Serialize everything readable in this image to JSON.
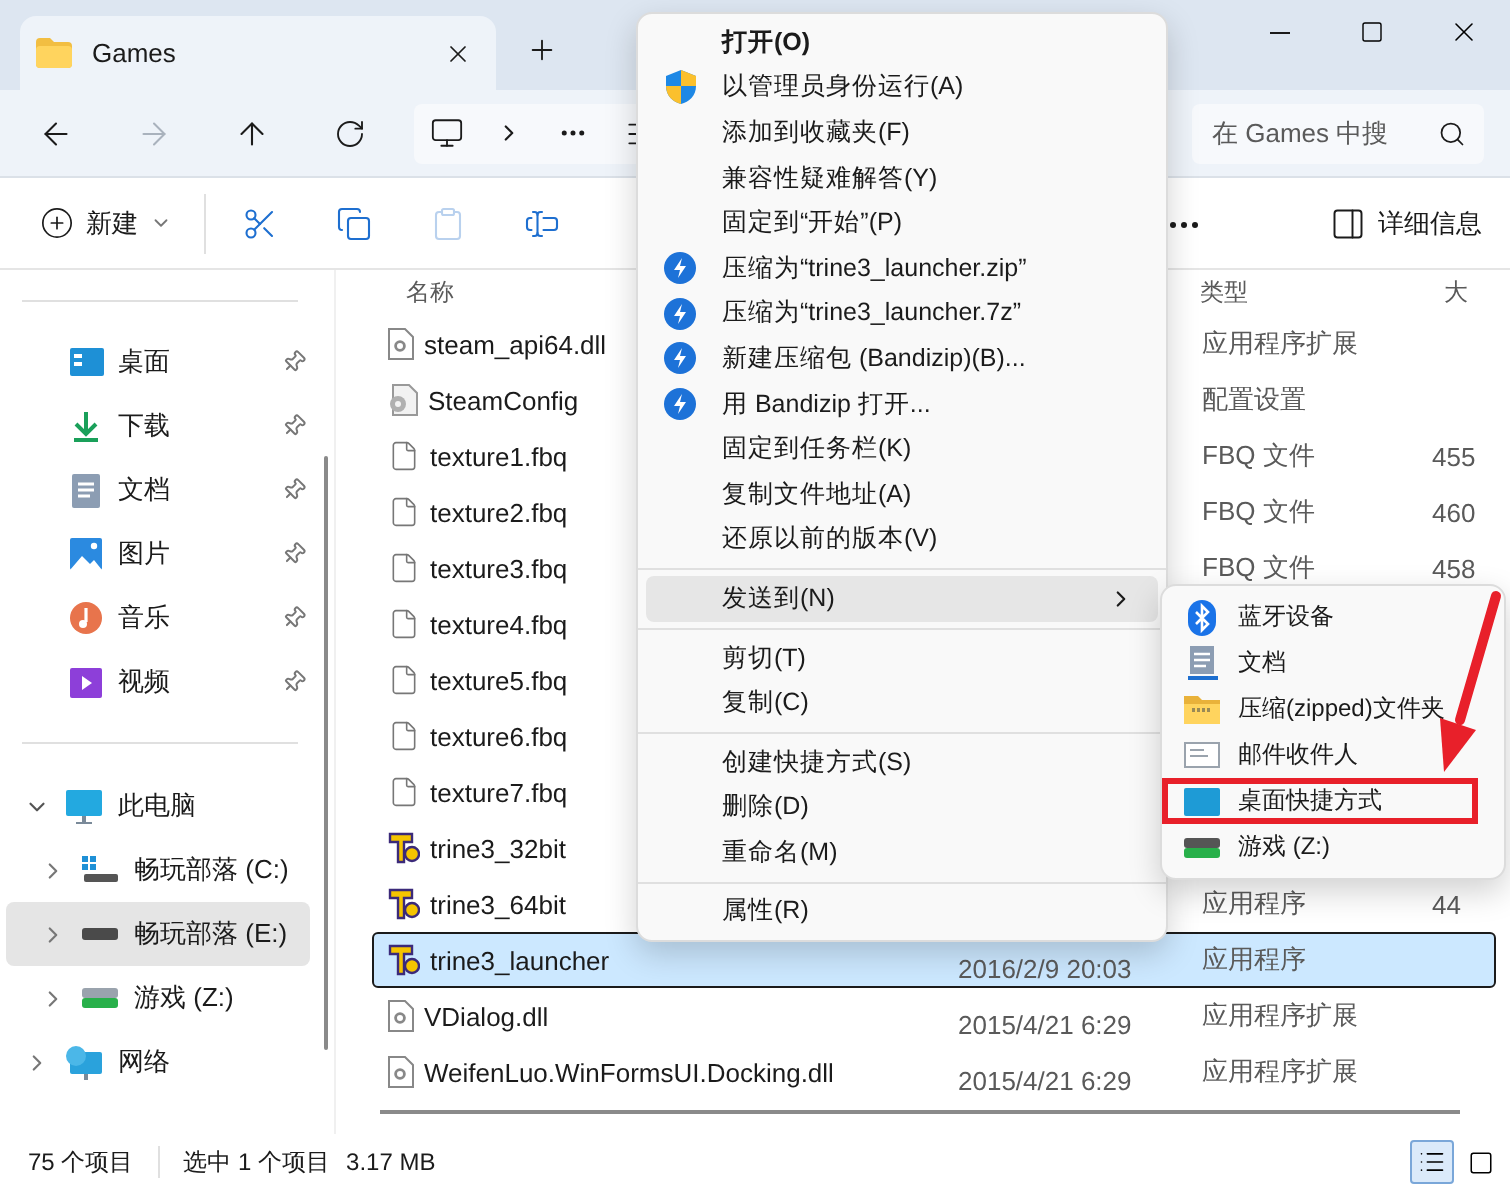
{
  "window": {
    "tab_title": "Games"
  },
  "nav": {
    "back_disabled": false,
    "forward_disabled": true,
    "search_placeholder": "在 Games 中搜"
  },
  "toolbar": {
    "new_label": "新建",
    "details_label": "详细信息",
    "icon_buttons": [
      {
        "kind": "cut",
        "disabled": false
      },
      {
        "kind": "copy",
        "disabled": false
      },
      {
        "kind": "paste",
        "disabled": true
      },
      {
        "kind": "rename",
        "disabled": false
      }
    ]
  },
  "sidebar": {
    "quick_access": [
      {
        "label": "桌面",
        "kind": "desktop",
        "pinned": true
      },
      {
        "label": "下载",
        "kind": "download",
        "pinned": true
      },
      {
        "label": "文档",
        "kind": "document",
        "pinned": true
      },
      {
        "label": "图片",
        "kind": "picture",
        "pinned": true
      },
      {
        "label": "音乐",
        "kind": "music",
        "pinned": true
      },
      {
        "label": "视频",
        "kind": "video",
        "pinned": true
      }
    ],
    "tree": [
      {
        "label": "此电脑",
        "kind": "pc",
        "expanded": true,
        "selected": false,
        "children": [
          {
            "label": "畅玩部落 (C:)",
            "kind": "system-drive",
            "expanded": false,
            "selected": false
          },
          {
            "label": "畅玩部落 (E:)",
            "kind": "drive",
            "expanded": false,
            "selected": true
          },
          {
            "label": "游戏 (Z:)",
            "kind": "game-drive",
            "expanded": false,
            "selected": false
          }
        ]
      },
      {
        "label": "网络",
        "kind": "network",
        "expanded": false,
        "selected": false
      }
    ]
  },
  "files": {
    "header": {
      "name": "名称",
      "type": "类型",
      "size": "大"
    },
    "rows": [
      {
        "name": "steam_api64.dll",
        "kind": "dll",
        "type": "应用程序扩展",
        "selected": false
      },
      {
        "name": "SteamConfig",
        "kind": "config",
        "type": "配置设置",
        "selected": false
      },
      {
        "name": "texture1.fbq",
        "kind": "file",
        "type": "FBQ 文件",
        "size": "455",
        "selected": false
      },
      {
        "name": "texture2.fbq",
        "kind": "file",
        "type": "FBQ 文件",
        "size": "460",
        "selected": false
      },
      {
        "name": "texture3.fbq",
        "kind": "file",
        "type": "FBQ 文件",
        "size": "458",
        "selected": false
      },
      {
        "name": "texture4.fbq",
        "kind": "file",
        "selected": false
      },
      {
        "name": "texture5.fbq",
        "kind": "file",
        "selected": false
      },
      {
        "name": "texture6.fbq",
        "kind": "file",
        "selected": false
      },
      {
        "name": "texture7.fbq",
        "kind": "file",
        "selected": false
      },
      {
        "name": "trine3_32bit",
        "kind": "app",
        "selected": false
      },
      {
        "name": "trine3_64bit",
        "kind": "app",
        "type": "应用程序",
        "size": "44",
        "selected": false
      },
      {
        "name": "trine3_launcher",
        "kind": "app",
        "date": "2016/2/9 20:03",
        "type": "应用程序",
        "selected": true
      },
      {
        "name": "VDialog.dll",
        "kind": "dll",
        "date": "2015/4/21 6:29",
        "type": "应用程序扩展",
        "selected": false
      },
      {
        "name": "WeifenLuo.WinFormsUI.Docking.dll",
        "kind": "dll",
        "date": "2015/4/21 6:29",
        "type": "应用程序扩展",
        "selected": false
      }
    ]
  },
  "context_menu": {
    "items": [
      {
        "label": "打开(O)",
        "kind": "bold",
        "highlighted": false
      },
      {
        "label": "以管理员身份运行(A)",
        "kind": "shield",
        "highlighted": false
      },
      {
        "label": "添加到收藏夹(F)",
        "kind": "plain",
        "highlighted": false
      },
      {
        "label": "兼容性疑难解答(Y)",
        "kind": "plain",
        "highlighted": false
      },
      {
        "label": "固定到“开始”(P)",
        "kind": "plain",
        "highlighted": false
      },
      {
        "label": "压缩为“trine3_launcher.zip”",
        "kind": "bandizip",
        "highlighted": false
      },
      {
        "label": "压缩为“trine3_launcher.7z”",
        "kind": "bandizip",
        "highlighted": false
      },
      {
        "label": "新建压缩包 (Bandizip)(B)...",
        "kind": "bandizip",
        "highlighted": false
      },
      {
        "label": "用 Bandizip 打开...",
        "kind": "bandizip",
        "highlighted": false
      },
      {
        "label": "固定到任务栏(K)",
        "kind": "plain",
        "highlighted": false
      },
      {
        "label": "复制文件地址(A)",
        "kind": "plain",
        "highlighted": false
      },
      {
        "label": "还原以前的版本(V)",
        "kind": "plain",
        "highlighted": false
      },
      {
        "kind": "separator"
      },
      {
        "label": "发送到(N)",
        "kind": "submenu",
        "highlighted": true
      },
      {
        "kind": "separator"
      },
      {
        "label": "剪切(T)",
        "kind": "plain",
        "highlighted": false
      },
      {
        "label": "复制(C)",
        "kind": "plain",
        "highlighted": false
      },
      {
        "kind": "separator"
      },
      {
        "label": "创建快捷方式(S)",
        "kind": "plain",
        "highlighted": false
      },
      {
        "label": "删除(D)",
        "kind": "plain",
        "highlighted": false
      },
      {
        "label": "重命名(M)",
        "kind": "plain",
        "highlighted": false
      },
      {
        "kind": "separator"
      },
      {
        "label": "属性(R)",
        "kind": "plain",
        "highlighted": false
      }
    ]
  },
  "send_to_menu": {
    "items": [
      {
        "label": "蓝牙设备",
        "kind": "bluetooth",
        "marked": false
      },
      {
        "label": "文档",
        "kind": "document",
        "marked": false
      },
      {
        "label": "压缩(zipped)文件夹",
        "kind": "zip",
        "marked": false
      },
      {
        "label": "邮件收件人",
        "kind": "mail",
        "marked": false
      },
      {
        "label": "桌面快捷方式",
        "kind": "desktop",
        "marked": true
      },
      {
        "label": "游戏 (Z:)",
        "kind": "game-drive",
        "marked": false
      }
    ]
  },
  "status_bar": {
    "item_count": "75 个项目",
    "selection": "选中 1 个项目",
    "selection_size": "3.17 MB",
    "views": [
      {
        "kind": "details",
        "selected": true
      },
      {
        "kind": "tiles",
        "selected": false
      }
    ]
  }
}
